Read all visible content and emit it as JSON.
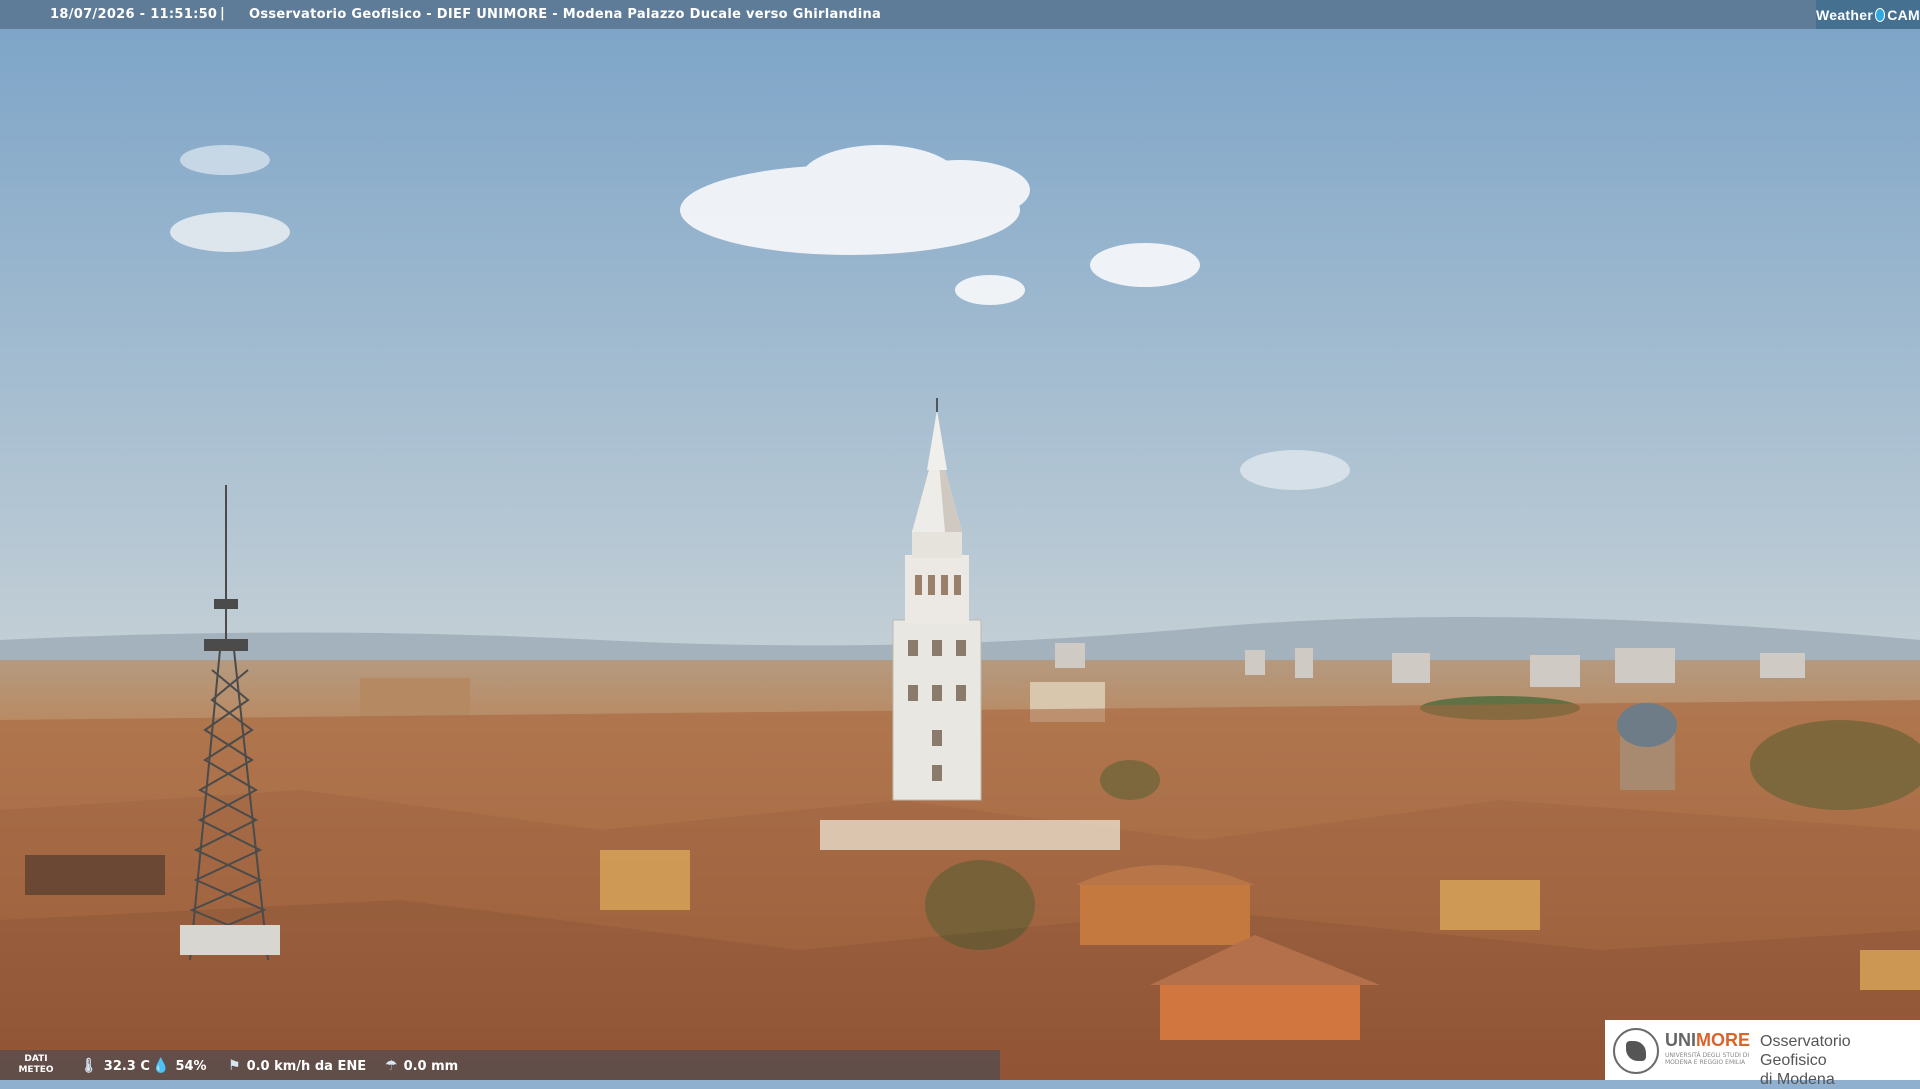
{
  "header": {
    "timestamp": "18/07/2026 - 11:51:50",
    "separator": "|",
    "title": "Osservatorio Geofisico - DIEF UNIMORE - Modena Palazzo Ducale verso Ghirlandina",
    "brand_weather": "Weather",
    "brand_cam": "CAM"
  },
  "weather": {
    "label_line1": "DATI",
    "label_line2": "METEO",
    "temperature": "32.3 C",
    "humidity": "54%",
    "wind": "0.0 km/h da ENE",
    "rain": "0.0 mm",
    "icons": [
      "thermometer-icon",
      "humidity-icon",
      "wind-icon",
      "rain-icon"
    ]
  },
  "footer_logo": {
    "brand_uni": "UNI",
    "brand_more": "MORE",
    "university": "UNIVERSITÀ DEGLI STUDI DI MODENA E REGGIO EMILIA",
    "observatory_line1": "Osservatorio Geofisico",
    "observatory_line2": "di Modena"
  },
  "colors": {
    "topbar": "#5e7c98",
    "sky_top": "#7ea5c8",
    "sky_bottom": "#b9c9d3",
    "roofs": "#b07a52",
    "unimore_accent": "#d9652b"
  }
}
